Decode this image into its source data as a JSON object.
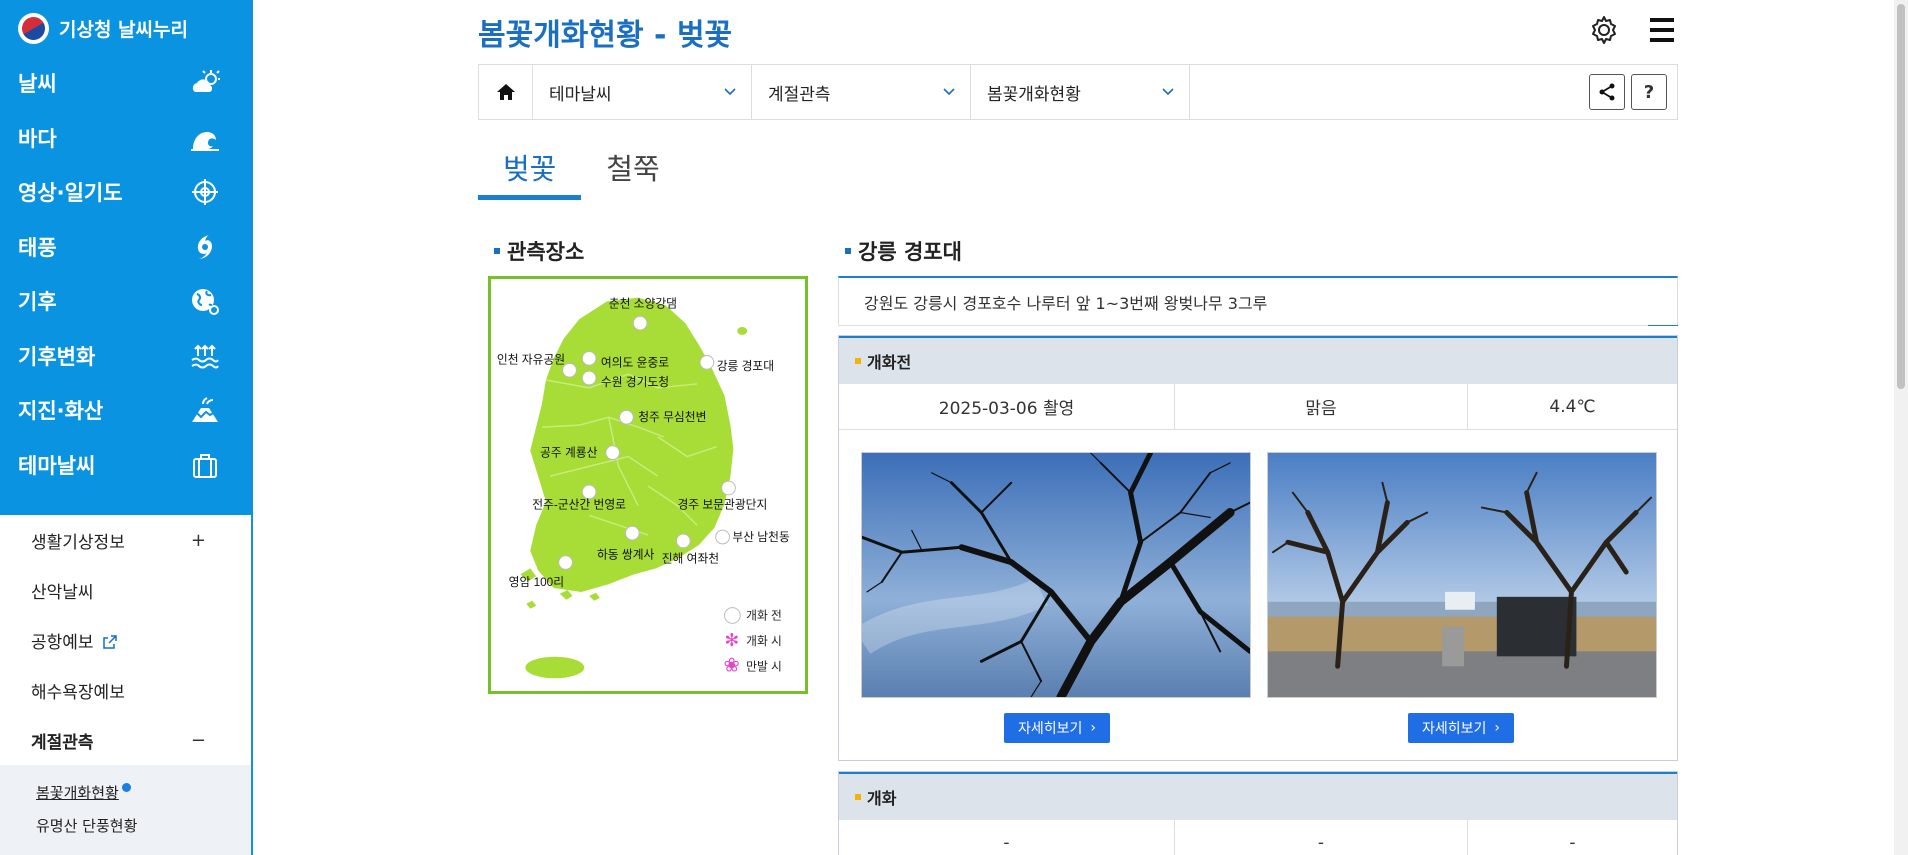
{
  "sidebar": {
    "logo": "기상청 날씨누리",
    "menu": [
      {
        "label": "날씨",
        "icon": "weather-icon"
      },
      {
        "label": "바다",
        "icon": "wave-icon"
      },
      {
        "label": "영상·일기도",
        "icon": "satellite-icon"
      },
      {
        "label": "태풍",
        "icon": "typhoon-icon"
      },
      {
        "label": "기후",
        "icon": "globe-icon"
      },
      {
        "label": "기후변화",
        "icon": "flood-icon"
      },
      {
        "label": "지진·화산",
        "icon": "volcano-icon"
      },
      {
        "label": "테마날씨",
        "icon": "bag-icon"
      }
    ],
    "submenu": [
      {
        "label": "생활기상정보",
        "toggle": "+"
      },
      {
        "label": "산악날씨",
        "toggle": ""
      },
      {
        "label": "공항예보",
        "toggle": ""
      },
      {
        "label": "해수욕장예보",
        "toggle": ""
      },
      {
        "label": "계절관측",
        "toggle": "−"
      }
    ],
    "sub2": [
      {
        "label": "봄꽃개화현황"
      },
      {
        "label": "유명산 단풍현황"
      }
    ]
  },
  "page": {
    "title": "봄꽃개화현황 - 벚꽃",
    "breadcrumb": [
      "테마날씨",
      "계절관측",
      "봄꽃개화현황"
    ],
    "help_label": "?",
    "tabs": [
      "벚꽃",
      "철쭉"
    ]
  },
  "map": {
    "title": "관측장소",
    "stations": [
      "춘천 소양강댐",
      "인천 자유공원",
      "여의도 윤중로",
      "수원 경기도청",
      "강릉 경포대",
      "청주 무심천변",
      "공주 계룡산",
      "전주-군산간 번영로",
      "경주 보문관광단지",
      "부산 남천동",
      "하동 쌍계사",
      "진해 여좌천",
      "영암 100리"
    ],
    "legend": [
      "개화 전",
      "개화 시",
      "만발 시"
    ]
  },
  "location": {
    "title": "강릉 경포대",
    "description": "강원도 강릉시 경포호수 나루터 앞 1~3번째 왕벚나무 3그루"
  },
  "stages": [
    {
      "label": "개화전",
      "date": "2025-03-06 촬영",
      "weather": "맑음",
      "temp": "4.4℃",
      "buttons": [
        "자세히보기",
        "자세히보기"
      ]
    },
    {
      "label": "개화",
      "date": "-",
      "weather": "-",
      "temp": "-"
    }
  ],
  "colors": {
    "sidebar_blue": "#0a93e0",
    "title_blue": "#1a6fc2",
    "map_green": "#a8dc37",
    "button_blue": "#1f6ee6",
    "highlight_yellow": "#ffd400"
  }
}
